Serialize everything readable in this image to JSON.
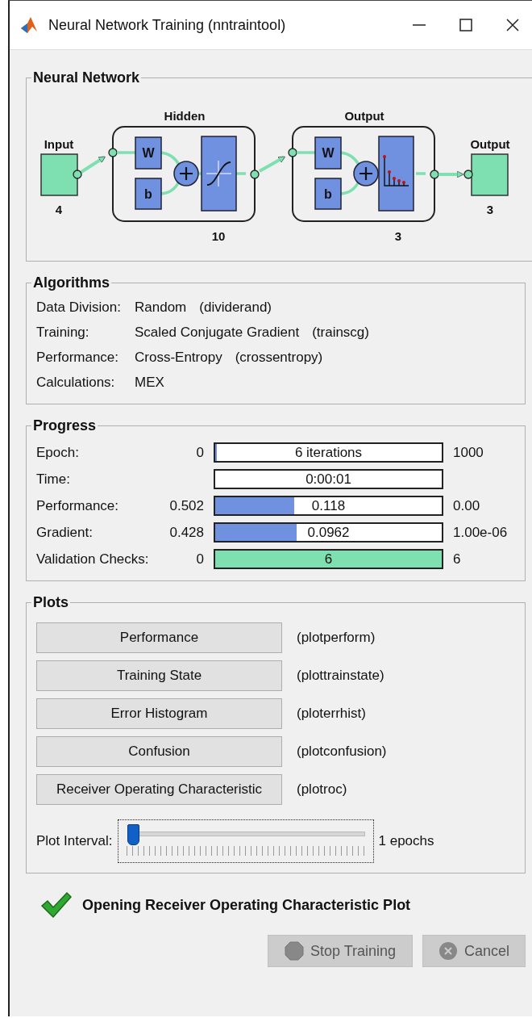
{
  "window": {
    "title": "Neural Network Training (nntraintool)"
  },
  "network": {
    "title": "Neural Network",
    "input": {
      "label": "Input",
      "size": "4"
    },
    "layers": [
      {
        "title": "Hidden",
        "size": "10",
        "weight_label": "W",
        "bias_label": "b",
        "kind": "tansig"
      },
      {
        "title": "Output",
        "size": "3",
        "weight_label": "W",
        "bias_label": "b",
        "kind": "softmax"
      }
    ],
    "output": {
      "label": "Output",
      "size": "3"
    }
  },
  "algorithms": {
    "title": "Algorithms",
    "rows": [
      {
        "label": "Data Division:",
        "value": "Random",
        "function": "(dividerand)"
      },
      {
        "label": "Training:",
        "value": "Scaled Conjugate Gradient",
        "function": "(trainscg)"
      },
      {
        "label": "Performance:",
        "value": "Cross-Entropy",
        "function": "(crossentropy)"
      },
      {
        "label": "Calculations:",
        "value": "MEX"
      }
    ]
  },
  "progress": {
    "title": "Progress",
    "rows": [
      {
        "label": "Epoch:",
        "start": "0",
        "value": "6 iterations",
        "end": "1000",
        "level": 0.006,
        "color": "#7090e0"
      },
      {
        "label": "Time:",
        "value": "0:00:01"
      },
      {
        "label": "Performance:",
        "start": "0.502",
        "value": "0.118",
        "end": "0.00",
        "level": 0.35,
        "color": "#7090e0"
      },
      {
        "label": "Gradient:",
        "start": "0.428",
        "value": "0.0962",
        "end": "1.00e-06",
        "level": 0.36,
        "color": "#7090e0"
      },
      {
        "label": "Validation Checks:",
        "start": "0",
        "value": "6",
        "end": "6",
        "level": 1,
        "color": "#7ee0b0"
      }
    ]
  },
  "plots": {
    "title": "Plots",
    "buttons": [
      {
        "label": "Performance",
        "function": "(plotperform)"
      },
      {
        "label": "Training State",
        "function": "(plottrainstate)"
      },
      {
        "label": "Error Histogram",
        "function": "(ploterrhist)"
      },
      {
        "label": "Confusion",
        "function": "(plotconfusion)"
      },
      {
        "label": "Receiver Operating Characteristic",
        "function": "(plotroc)"
      }
    ],
    "interval": {
      "label": "Plot Interval:",
      "level": 0,
      "reading": "1 epochs"
    }
  },
  "status": {
    "message": "Opening Receiver Operating Characteristic Plot",
    "done": true
  },
  "buttons": [
    {
      "label": "Stop Training",
      "kind": "stop",
      "disabled": true
    },
    {
      "label": "Cancel",
      "kind": "cancel",
      "disabled": true
    }
  ]
}
